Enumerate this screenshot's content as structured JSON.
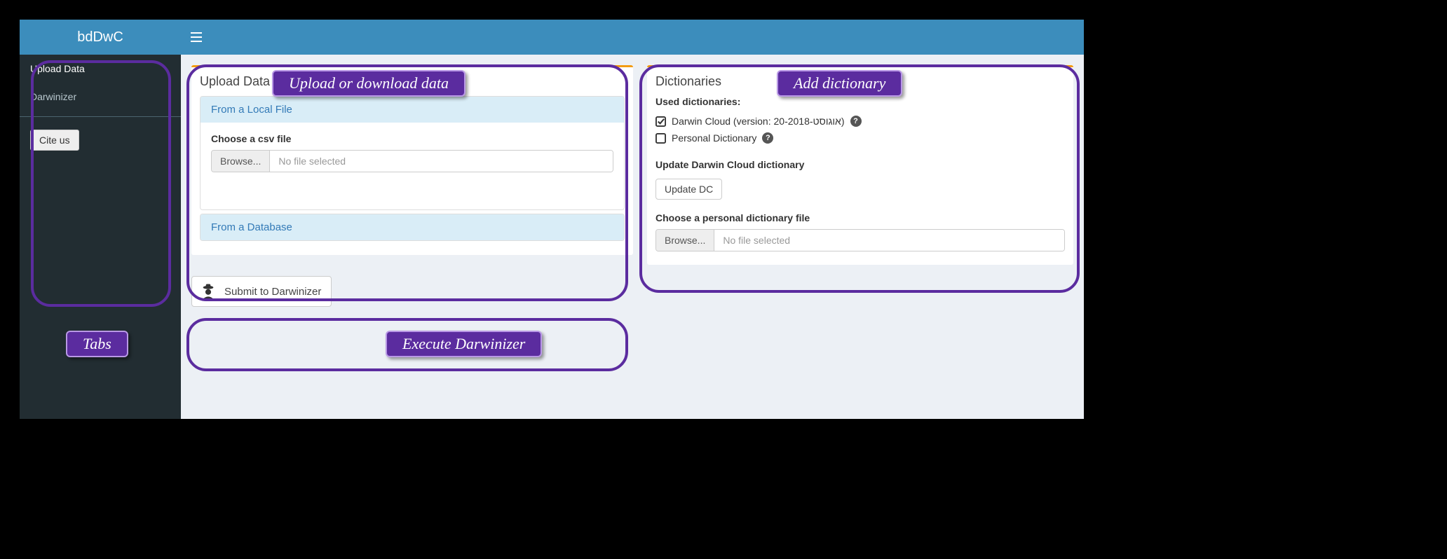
{
  "app": {
    "title": "bdDwC"
  },
  "sidebar": {
    "items": [
      {
        "label": "Upload Data",
        "active": true
      },
      {
        "label": "Darwinizer",
        "active": false
      }
    ],
    "cite_label": "Cite us"
  },
  "upload_box": {
    "title": "Upload Data",
    "panels": [
      {
        "title": "From a Local File",
        "open": true,
        "file_label": "Choose a csv file",
        "browse_label": "Browse...",
        "status_text": "No file selected"
      },
      {
        "title": "From a Database",
        "open": false
      }
    ]
  },
  "submit": {
    "label": "Submit to Darwinizer"
  },
  "dict_box": {
    "title": "Dictionaries",
    "used_label": "Used dictionaries:",
    "items": [
      {
        "checked": true,
        "label": "Darwin Cloud (version: 20-2018-אוגוסט)"
      },
      {
        "checked": false,
        "label": "Personal Dictionary"
      }
    ],
    "update_label": "Update Darwin Cloud dictionary",
    "update_btn": "Update DC",
    "personal_label": "Choose a personal dictionary file",
    "browse_label": "Browse...",
    "status_text": "No file selected"
  },
  "annotations": {
    "tabs": "Tabs",
    "upload": "Upload or download data",
    "dict": "Add dictionary",
    "exec": "Execute Darwinizer"
  }
}
